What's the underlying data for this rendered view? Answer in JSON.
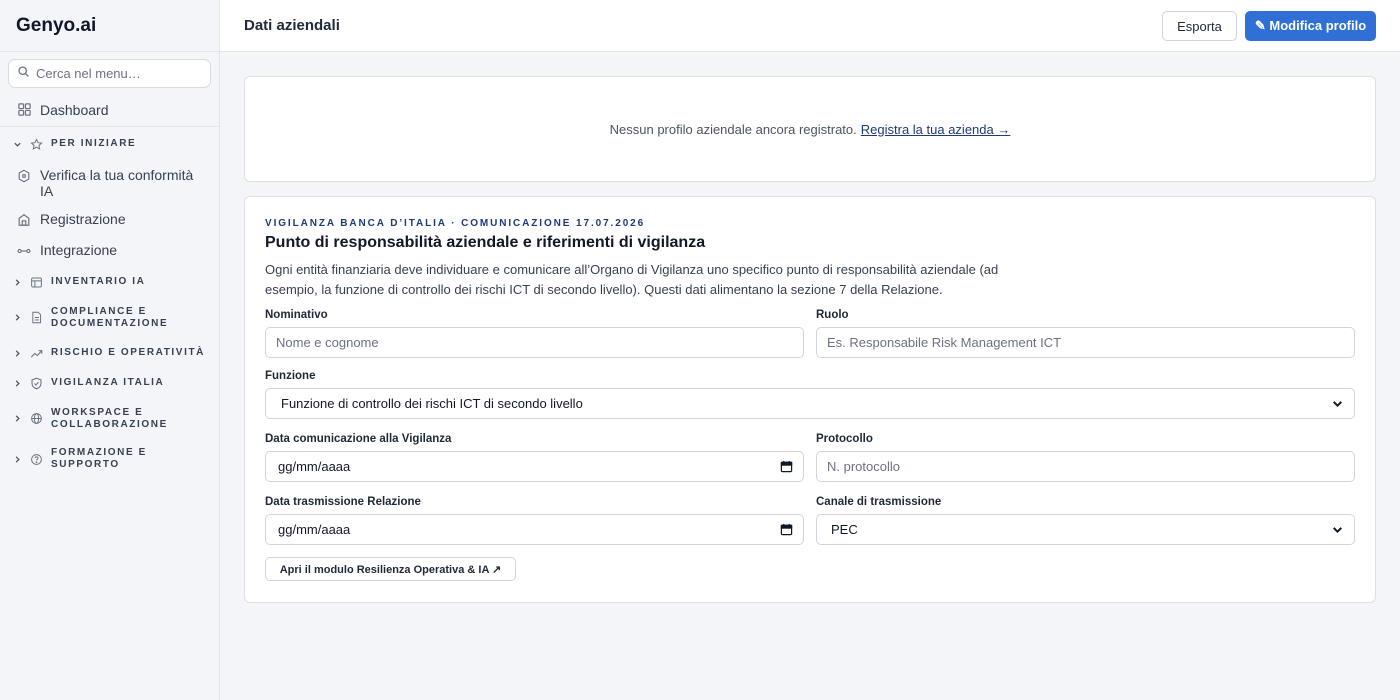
{
  "sidebar": {
    "brand": "Genyo.ai",
    "search_placeholder": "Cerca nel menu…",
    "dashboard": "Dashboard",
    "sections": [
      {
        "label": "PER INIZIARE",
        "expanded": true,
        "icon": "star-icon",
        "items": [
          {
            "label": "Verifica la tua conformità IA",
            "icon": "shield-hex-icon"
          },
          {
            "label": "Registrazione",
            "icon": "building-icon"
          },
          {
            "label": "Integrazione",
            "icon": "link-icon"
          }
        ]
      },
      {
        "label": "INVENTARIO IA",
        "icon": "table-icon"
      },
      {
        "label": "COMPLIANCE E DOCUMENTAZIONE",
        "line1": "COMPLIANCE E",
        "line2": "DOCUMENTAZIONE",
        "icon": "document-icon"
      },
      {
        "label": "RISCHIO E OPERATIVITÀ",
        "icon": "trend-icon"
      },
      {
        "label": "VIGILANZA ITALIA",
        "icon": "shield-check-icon"
      },
      {
        "label": "WORKSPACE E COLLABORAZIONE",
        "line1": "WORKSPACE E",
        "line2": "COLLABORAZIONE",
        "icon": "globe-icon"
      },
      {
        "label": "FORMAZIONE E SUPPORTO",
        "line1": "FORMAZIONE E",
        "line2": "SUPPORTO",
        "icon": "help-icon"
      }
    ]
  },
  "header": {
    "title": "Dati aziendali",
    "export_label": "Esporta",
    "edit_label": "✎ Modifica profilo"
  },
  "empty_state": {
    "text": "Nessun profilo aziendale ancora registrato.",
    "link": "Registra la tua azienda →"
  },
  "form": {
    "overline": "VIGILANZA BANCA D’ITALIA · COMUNICAZIONE 17.07.2026",
    "title": "Punto di responsabilità aziendale e riferimenti di vigilanza",
    "description": "Ogni entità finanziaria deve individuare e comunicare all’Organo di Vigilanza uno specifico punto di responsabilità aziendale (ad esempio, la funzione di controllo dei rischi ICT di secondo livello). Questi dati alimentano la sezione 7 della Relazione.",
    "fields": {
      "nominativo": {
        "label": "Nominativo",
        "placeholder": "Nome e cognome"
      },
      "ruolo": {
        "label": "Ruolo",
        "placeholder": "Es. Responsabile Risk Management ICT"
      },
      "funzione": {
        "label": "Funzione",
        "value": "Funzione di controllo dei rischi ICT di secondo livello"
      },
      "data_comunicazione": {
        "label": "Data comunicazione alla Vigilanza",
        "value": "gg/mm/aaaa"
      },
      "protocollo": {
        "label": "Protocollo",
        "placeholder": "N. protocollo"
      },
      "data_trasmissione": {
        "label": "Data trasmissione Relazione",
        "value": "gg/mm/aaaa"
      },
      "canale": {
        "label": "Canale di trasmissione",
        "value": "PEC"
      }
    },
    "module_button": "Apri il modulo Resilienza Operativa & IA ↗"
  }
}
